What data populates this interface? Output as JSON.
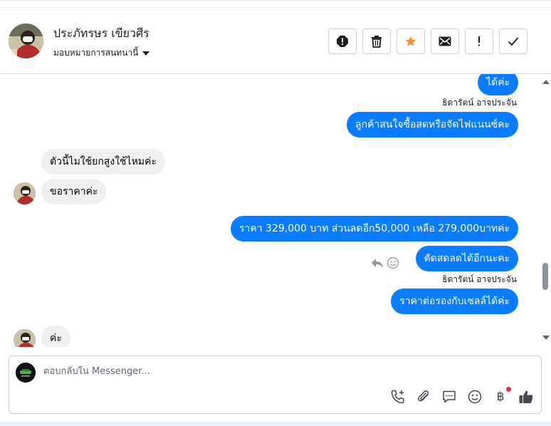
{
  "header": {
    "contact_name": "ประภัทรษร เขียวศีร",
    "assign_label": "มอบหมายการสนทนานี้"
  },
  "actions": [
    {
      "name": "spam",
      "icon": "alert-circle-icon"
    },
    {
      "name": "delete",
      "icon": "trash-icon"
    },
    {
      "name": "star",
      "icon": "star-icon"
    },
    {
      "name": "mark-unread",
      "icon": "envelope-icon"
    },
    {
      "name": "follow-up",
      "icon": "exclamation-icon"
    },
    {
      "name": "done",
      "icon": "check-icon"
    }
  ],
  "messages": {
    "m1": "ได้ค่ะ",
    "sender1": "ธิดารัตน์ อาจประจัน",
    "m2": "ลูกค้าสนใจซื้อสดหรือจัดไฟแนนซ์คะ",
    "m3": "ตัวนี้ไมใช้ยกสูงใช้ไหมค่ะ",
    "m4": "ขอราคาค่ะ",
    "m5": "ราคา 329,000 บาท ส่วนลดอีก50,000 เหลือ 279,000บาทค่ะ",
    "m6": "ตัดสดลดได้อีกนะคะ",
    "sender2": "ธิดารัตน์ อาจประจัน",
    "m7": "ราคาต่อรองกับเซลล์ได้ค่ะ",
    "m8": "ค่ะ"
  },
  "composer": {
    "placeholder": "ตอบกลับใน Messenger...",
    "baht_symbol": "฿"
  },
  "colors": {
    "outgoing_bubble": "#0a7cff",
    "incoming_bubble": "#f0f0f0",
    "star": "#f7923b",
    "notification_dot": "#f02849"
  }
}
